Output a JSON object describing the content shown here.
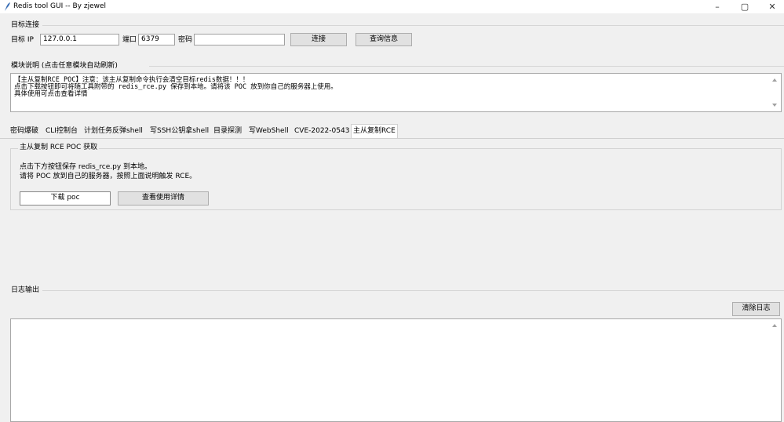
{
  "window": {
    "title": "Redis tool GUI -- By zjewel",
    "minimize": "–",
    "maximize": "▢",
    "close": "✕"
  },
  "connection": {
    "section_title": "目标连接",
    "ip_label": "目标 IP",
    "ip_value": "127.0.0.1",
    "port_label": "端口",
    "port_value": "6379",
    "password_label": "密码",
    "password_value": "",
    "connect_button": "连接",
    "query_button": "查询信息"
  },
  "module_desc": {
    "section_title": "模块说明 (点击任意模块自动刷新)",
    "lines": [
      "【主从复制RCE POC】注意：该主从复制命令执行会清空目标redis数据！！！",
      "点击下载按钮即可将随工具附带的 redis_rce.py 保存到本地。请将该 POC 放到你自己的服务器上使用。",
      "具体使用可点击查看详情"
    ]
  },
  "tabs": [
    {
      "label": "密码爆破"
    },
    {
      "label": "CLI控制台"
    },
    {
      "label": "计划任务反弹shell"
    },
    {
      "label": "写SSH公钥拿shell"
    },
    {
      "label": "目录探测"
    },
    {
      "label": "写WebShell"
    },
    {
      "label": "CVE-2022-0543"
    },
    {
      "label": "主从复制RCE"
    }
  ],
  "active_tab": "主从复制RCE",
  "rce_panel": {
    "group_title": "主从复制 RCE POC 获取",
    "line1": "点击下方按钮保存 redis_rce.py 到本地。",
    "line2": "请将 POC 放到自己的服务器，按照上面说明触发 RCE。",
    "download_button": "下载 poc",
    "details_button": "查看使用详情"
  },
  "log": {
    "section_title": "日志输出",
    "clear_button": "清除日志",
    "content": ""
  }
}
